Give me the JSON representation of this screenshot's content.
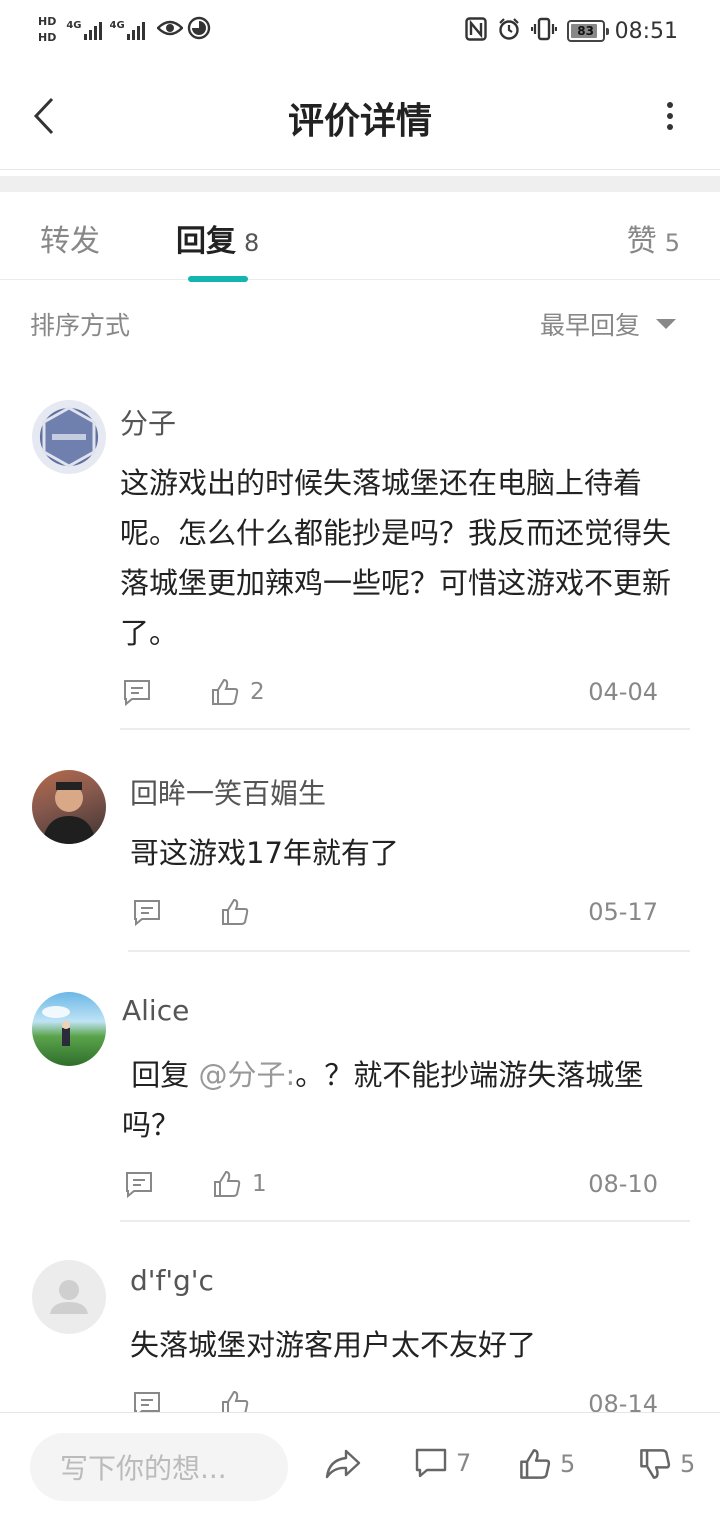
{
  "status_bar": {
    "time": "08:51",
    "battery": "83",
    "hd1": "HD",
    "hd2": "HD",
    "net1": "4G",
    "net2": "4G"
  },
  "header": {
    "title": "评价详情"
  },
  "tabs": [
    {
      "label": "转发",
      "count": ""
    },
    {
      "label": "回复",
      "count": "8"
    },
    {
      "label": "赞",
      "count": "5"
    }
  ],
  "sort": {
    "label": "排序方式",
    "value": "最早回复"
  },
  "comments": [
    {
      "user": "分子",
      "text": "这游戏出的时候失落城堡还在电脑上待着呢。怎么什么都能抄是吗？我反而还觉得失落城堡更加辣鸡一些呢？可惜这游戏不更新了。",
      "likes": "2",
      "date": "04-04"
    },
    {
      "user": "回眸一笑百媚生",
      "text": "哥这游戏17年就有了",
      "likes": "",
      "date": "05-17"
    },
    {
      "user": "Alice",
      "reply_prefix": "回复",
      "mention": "@分子:",
      "text": "。？就不能抄端游失落城堡吗？",
      "likes": "1",
      "date": "08-10"
    },
    {
      "user": "d'f'g'c",
      "text": "失落城堡对游客用户太不友好了",
      "likes": "",
      "date": "08-14"
    }
  ],
  "bottom_bar": {
    "placeholder": "写下你的想...",
    "comment_count": "7",
    "like_count": "5",
    "dislike_count": "5"
  },
  "colors": {
    "accent": "#14b4b0",
    "text": "#222222",
    "muted": "#888888"
  },
  "icons": [
    "back-icon",
    "more-icon",
    "reply-icon",
    "thumb-up-icon",
    "share-icon",
    "comment-icon",
    "thumb-down-icon",
    "caret-down-icon"
  ]
}
